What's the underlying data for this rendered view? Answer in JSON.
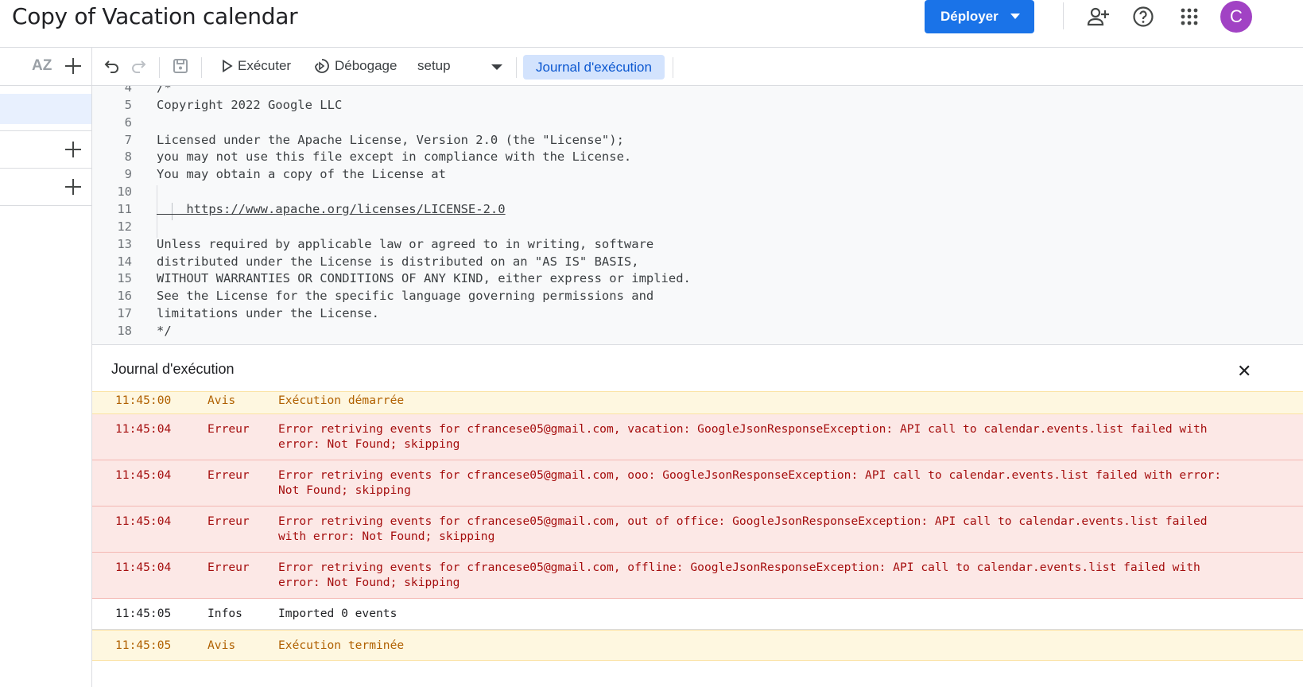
{
  "header": {
    "title": "Copy of Vacation calendar",
    "deploy_label": "Déployer",
    "avatar_letter": "C",
    "icons": [
      "add-person-icon",
      "help-icon",
      "apps-grid-icon"
    ]
  },
  "left_panel": {
    "sort_icon_label": "AZ"
  },
  "toolbar": {
    "run_label": "Exécuter",
    "debug_label": "Débogage",
    "function_select": "setup",
    "log_label": "Journal d'exécution"
  },
  "code": [
    {
      "n": "4",
      "text": "/*"
    },
    {
      "n": "5",
      "text": "Copyright 2022 Google LLC"
    },
    {
      "n": "6",
      "text": ""
    },
    {
      "n": "7",
      "text": "Licensed under the Apache License, Version 2.0 (the \"License\");"
    },
    {
      "n": "8",
      "text": "you may not use this file except in compliance with the License."
    },
    {
      "n": "9",
      "text": "You may obtain a copy of the License at"
    },
    {
      "n": "10",
      "text": ""
    },
    {
      "n": "11",
      "text": "    https://www.apache.org/licenses/LICENSE-2.0"
    },
    {
      "n": "12",
      "text": ""
    },
    {
      "n": "13",
      "text": "Unless required by applicable law or agreed to in writing, software"
    },
    {
      "n": "14",
      "text": "distributed under the License is distributed on an \"AS IS\" BASIS,"
    },
    {
      "n": "15",
      "text": "WITHOUT WARRANTIES OR CONDITIONS OF ANY KIND, either express or implied."
    },
    {
      "n": "16",
      "text": "See the License for the specific language governing permissions and"
    },
    {
      "n": "17",
      "text": "limitations under the License."
    },
    {
      "n": "18",
      "text": "*/"
    }
  ],
  "log": {
    "title": "Journal d'exécution",
    "close_label": "✕",
    "entries": [
      {
        "time": "11:45:00",
        "level": "Avis",
        "message": "Exécution démarrée",
        "kind": "notice"
      },
      {
        "time": "11:45:04",
        "level": "Erreur",
        "message": "Error retriving events for cfrancese05@gmail.com, vacation: GoogleJsonResponseException: API call to calendar.events.list failed with\nerror: Not Found; skipping",
        "kind": "error"
      },
      {
        "time": "11:45:04",
        "level": "Erreur",
        "message": "Error retriving events for cfrancese05@gmail.com, ooo: GoogleJsonResponseException: API call to calendar.events.list failed with error:\nNot Found; skipping",
        "kind": "error"
      },
      {
        "time": "11:45:04",
        "level": "Erreur",
        "message": "Error retriving events for cfrancese05@gmail.com, out of office: GoogleJsonResponseException: API call to calendar.events.list failed\nwith error: Not Found; skipping",
        "kind": "error"
      },
      {
        "time": "11:45:04",
        "level": "Erreur",
        "message": "Error retriving events for cfrancese05@gmail.com, offline: GoogleJsonResponseException: API call to calendar.events.list failed with\nerror: Not Found; skipping",
        "kind": "error"
      },
      {
        "time": "11:45:05",
        "level": "Infos",
        "message": "Imported 0 events",
        "kind": "info"
      },
      {
        "time": "11:45:05",
        "level": "Avis",
        "message": "Exécution terminée",
        "kind": "notice"
      }
    ]
  },
  "colors": {
    "accent": "#1a73e8",
    "notice_bg": "#fef7e0",
    "error_bg": "#fce8e6",
    "avatar": "#a142c4"
  }
}
